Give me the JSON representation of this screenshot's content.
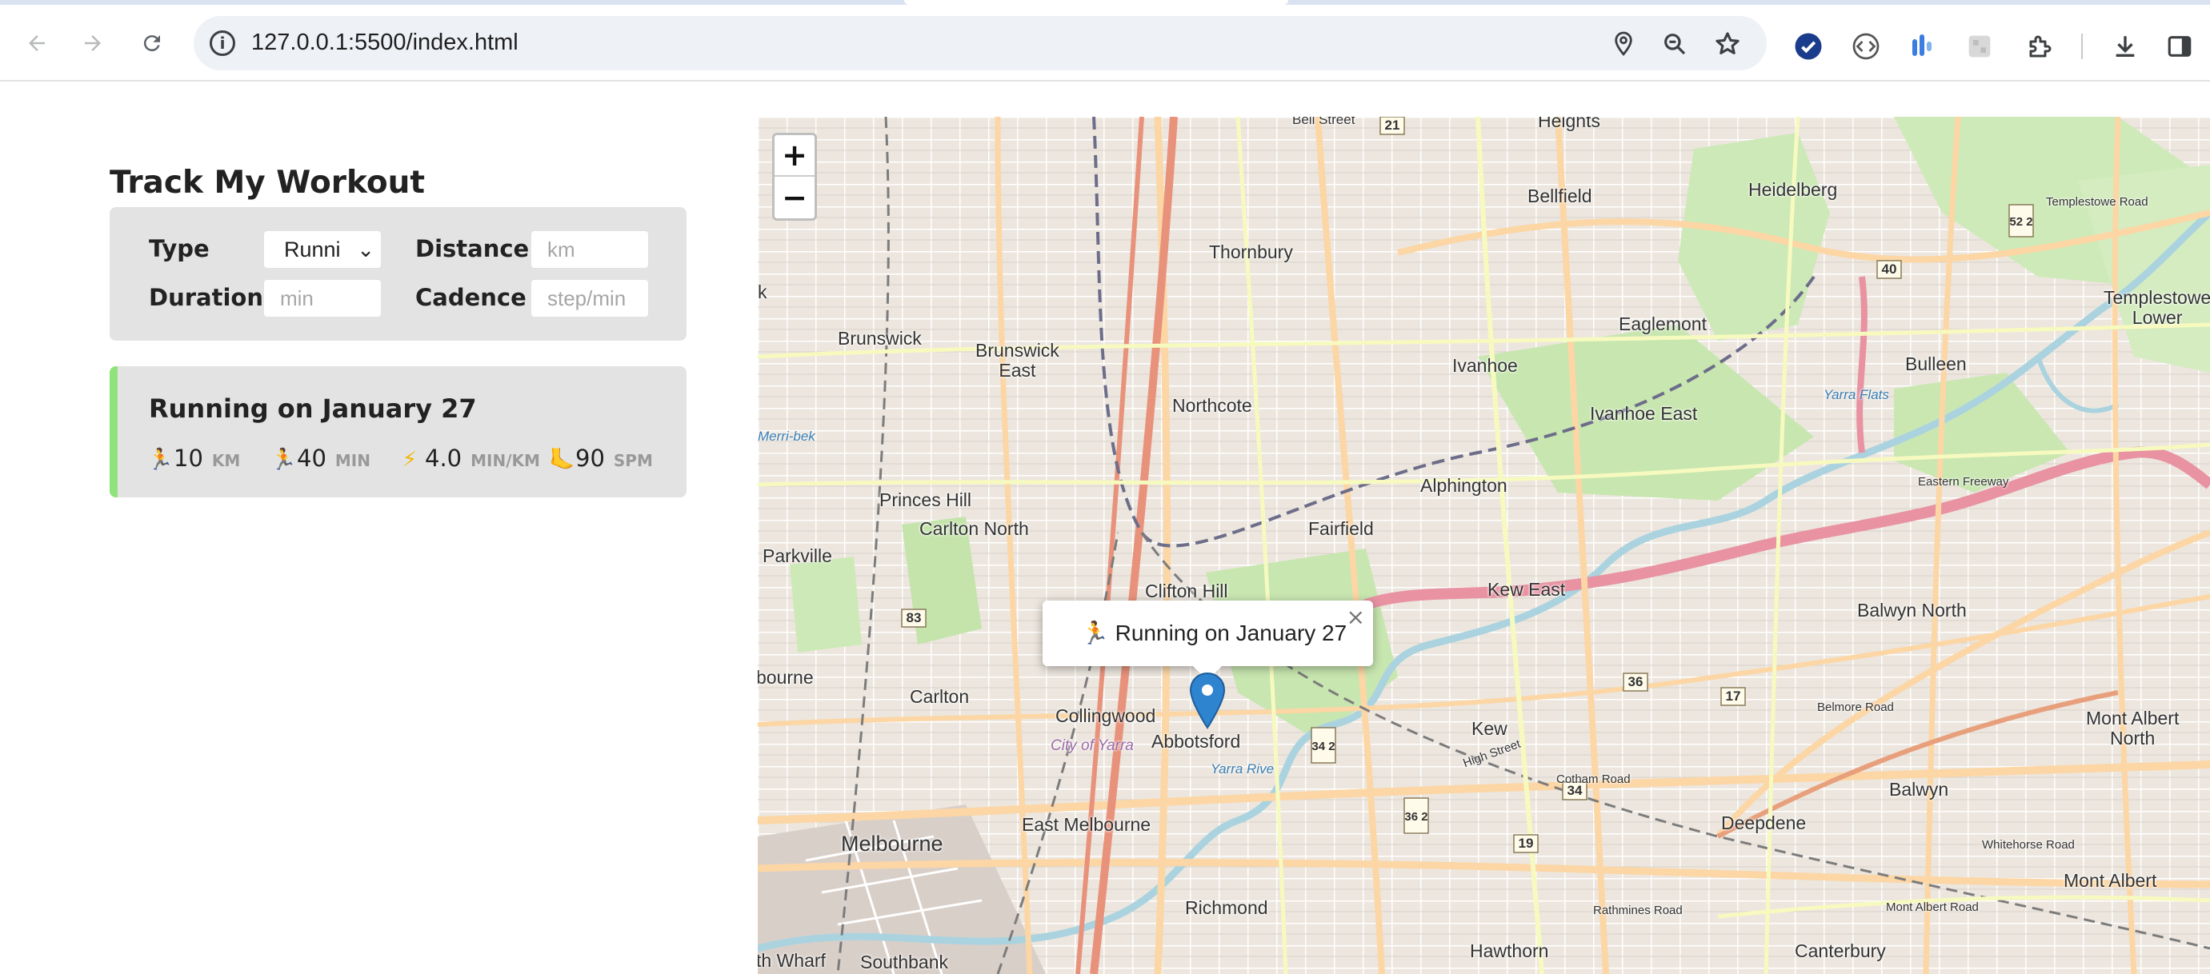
{
  "browser": {
    "url": "127.0.0.1:5500/index.html"
  },
  "app": {
    "title": "Track My Workout",
    "form": {
      "type_label": "Type",
      "type_value": "Runni",
      "distance_label": "Distance",
      "distance_placeholder": "km",
      "duration_label": "Duration",
      "duration_placeholder": "min",
      "cadence_label": "Cadence",
      "cadence_placeholder": "step/min"
    },
    "workouts": [
      {
        "title": "Running on January 27",
        "color": "#8fe37a",
        "stats": [
          {
            "icon": "🏃",
            "value": "10",
            "unit": "KM"
          },
          {
            "icon": "🏃",
            "value": "40",
            "unit": "MIN"
          },
          {
            "icon": "⚡",
            "value": "4.0",
            "unit": "MIN/KM"
          },
          {
            "icon": "🦶",
            "value": "90",
            "unit": "SPM"
          }
        ]
      }
    ]
  },
  "map": {
    "zoom_in": "+",
    "zoom_out": "−",
    "popup_text": "🏃 Running on January 27",
    "popup_close": "×",
    "labels": {
      "bell_street": "Bell Street",
      "heights": "Heights",
      "heidelberg": "Heidelberg",
      "bellfield": "Bellfield",
      "templestowe_road": "Templestowe Road",
      "thornbury": "Thornbury",
      "brunswick": "Brunswick",
      "brunswick_east": "Brunswick\nEast",
      "eaglemont": "Eaglemont",
      "templestowe_lower": "Templestowe\nLower",
      "ivanhoe": "Ivanhoe",
      "bulleen": "Bulleen",
      "northcote": "Northcote",
      "ivanhoe_east": "Ivanhoe East",
      "yarra_flats": "Yarra Flats",
      "eastern_freeway": "Eastern Freeway",
      "alphington": "Alphington",
      "princes_hill": "Princes Hill",
      "carlton_north": "Carlton North",
      "fairfield": "Fairfield",
      "parkville": "Parkville",
      "clifton_hill": "Clifton Hill",
      "kew_east": "Kew East",
      "balwyn_north": "Balwyn North",
      "bourne": "bourne",
      "carlton": "Carlton",
      "collingwood": "Collingwood",
      "abbotsford": "Abbotsford",
      "city_of_yarra": "City of Yarra",
      "kew": "Kew",
      "mont_albert_north": "Mont Albert\nNorth",
      "belmore_road": "Belmore Road",
      "east_melbourne": "East Melbourne",
      "deepdene": "Deepdene",
      "balwyn": "Balwyn",
      "melbourne": "Melbourne",
      "whitehorse_road": "Whitehorse Road",
      "mont_albert": "Mont Albert",
      "richmond": "Richmond",
      "hawthorn": "Hawthorn",
      "canterbury": "Canterbury",
      "southbank": "Southbank",
      "wharf": "th Wharf",
      "cotham_road": "Cotham Road",
      "high_street": "High Street",
      "rathmines_road": "Rathmines Road",
      "mont_albert_road": "Mont Albert Road",
      "yarra_river": "Yarra Rive",
      "merri_bek": "Merri-bek",
      "k": "k"
    },
    "shields": [
      "21",
      "40",
      "52 2",
      "83",
      "36",
      "17",
      "34 2",
      "36 2",
      "34",
      "19"
    ]
  }
}
